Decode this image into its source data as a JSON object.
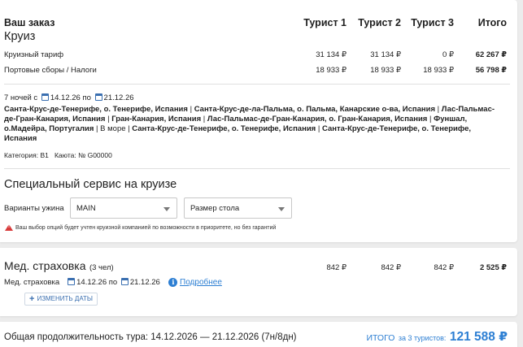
{
  "order": {
    "title": "Ваш заказ",
    "subtitle": "Круиз",
    "columns": [
      "Турист 1",
      "Турист 2",
      "Турист 3",
      "Итого"
    ],
    "rows": [
      {
        "label": "Круизный тариф",
        "values": [
          "31 134 ₽",
          "31 134 ₽",
          "0 ₽",
          "62 267 ₽"
        ]
      },
      {
        "label": "Портовые сборы / Налоги",
        "values": [
          "18 933 ₽",
          "18 933 ₽",
          "18 933 ₽",
          "56 798 ₽"
        ]
      }
    ],
    "nights_label": "7 ночей с",
    "date_from": "14.12.26",
    "by_label": "по",
    "date_to": "21.12.26",
    "route": [
      "Санта-Крус-де-Тенерифе, о. Тенерифе, Испания",
      "Санта-Крус-де-ла-Пальма, о. Пальма, Канарские о-ва, Испания",
      "Лас-Пальмас-де-Гран-Канария, Испания",
      "Гран-Канария, Испания",
      "Лас-Пальмас-де-Гран-Канария, о. Гран-Канария, Испания",
      "Фуншал, о.Мадейра, Португалия",
      "В море",
      "Санта-Крус-де-Тенерифе, о. Тенерифе, Испания",
      "Санта-Крус-де-Тенерифе, о. Тенерифе, Испания"
    ],
    "category_label": "Категория:",
    "category_value": "B1",
    "cabin_label": "Каюта: №",
    "cabin_value": "G00000"
  },
  "special": {
    "title": "Специальный сервис на круизе",
    "dinner_label": "Варианты ужина",
    "dinner_value": "MAIN",
    "table_placeholder": "Размер стола",
    "warning": "Ваш выбор опций будет учтен круизной компанией по возможности в приоритете, но без гарантий"
  },
  "insurance": {
    "title": "Мед. страховка",
    "people": "(3 чел)",
    "values": [
      "842 ₽",
      "842 ₽",
      "842 ₽",
      "2 525 ₽"
    ],
    "row_label": "Мед. страховка",
    "date_from": "14.12.26",
    "by_label": "по",
    "date_to": "21.12.26",
    "details_link": "Подробнее",
    "change_dates_button": "ИЗМЕНИТЬ ДАТЫ"
  },
  "total": {
    "duration_text": "Общая продолжительность тура: 14.12.2026 — 21.12.2026 (7н/8дн)",
    "total_label": "ИТОГО",
    "for_label": "за 3 туристов:",
    "amount": "121 588 ₽"
  },
  "colors": {
    "accent": "#2d7fd3",
    "warning": "#d83a3a",
    "background": "#ececec"
  },
  "icons": [
    "calendar-icon",
    "warning-icon",
    "info-icon",
    "plus-icon",
    "chevron-down-icon"
  ]
}
